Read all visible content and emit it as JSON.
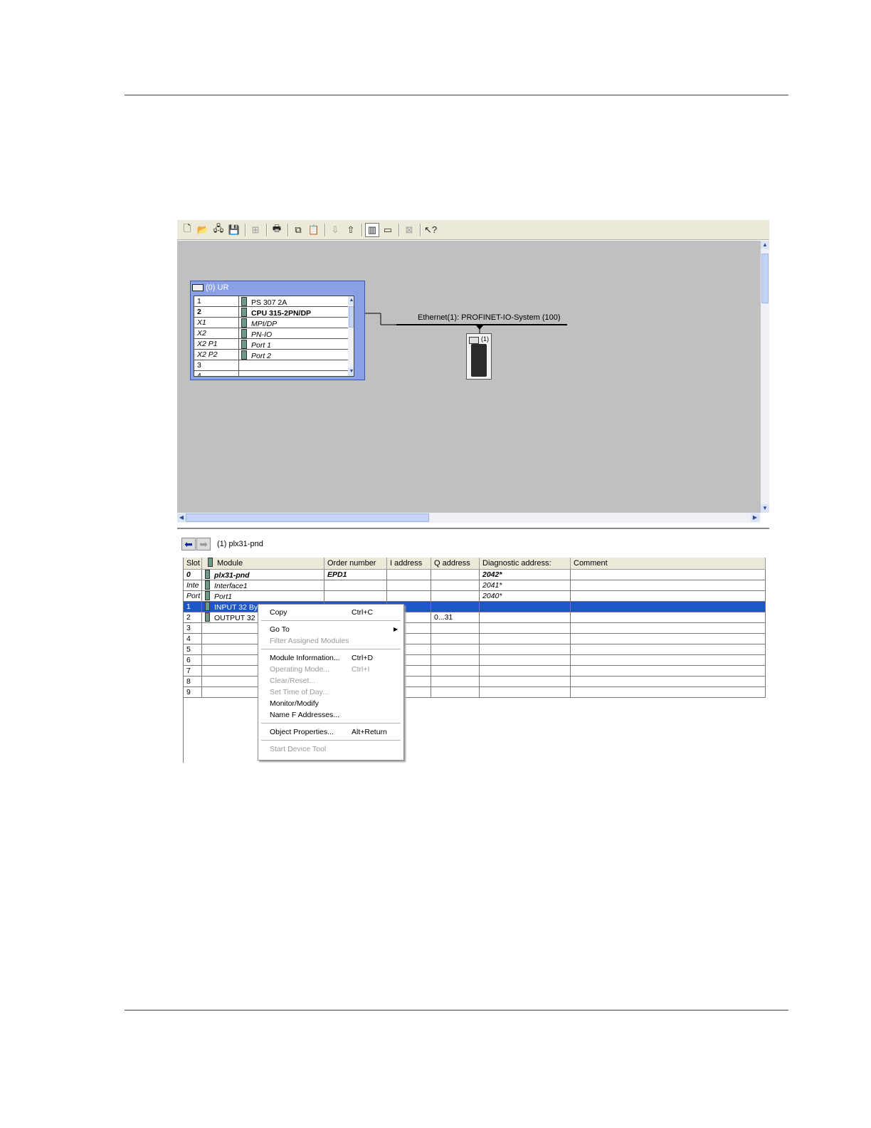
{
  "toolbar": {
    "icons": [
      {
        "name": "new-icon",
        "glyph": "🗋",
        "disabled": false
      },
      {
        "name": "open-icon",
        "glyph": "📂",
        "disabled": false
      },
      {
        "name": "accessible-nodes-icon",
        "glyph": "🖧",
        "disabled": false
      },
      {
        "name": "save-icon",
        "glyph": "💾",
        "disabled": true
      },
      {
        "name": "save-compile-icon",
        "glyph": "⊞",
        "disabled": true
      },
      {
        "name": "print-icon",
        "glyph": "🖶",
        "disabled": false
      },
      {
        "name": "copy-icon",
        "glyph": "⧉",
        "disabled": false
      },
      {
        "name": "paste-icon",
        "glyph": "📋",
        "disabled": true
      },
      {
        "name": "download-icon",
        "glyph": "⇩",
        "disabled": true
      },
      {
        "name": "upload-icon",
        "glyph": "⇧",
        "disabled": false
      },
      {
        "name": "catalog-icon",
        "glyph": "▥",
        "disabled": false,
        "active": true
      },
      {
        "name": "window-icon",
        "glyph": "▭",
        "disabled": false
      },
      {
        "name": "network-icon",
        "glyph": "⊠",
        "disabled": true
      },
      {
        "name": "help-icon",
        "glyph": "↖?",
        "disabled": false
      }
    ]
  },
  "rack": {
    "title": "(0) UR",
    "rows": [
      {
        "slot": "1",
        "module": "PS 307 2A",
        "bold": false,
        "italic": false
      },
      {
        "slot": "2",
        "module": "CPU 315-2PN/DP",
        "bold": true,
        "italic": false
      },
      {
        "slot": "X1",
        "module": "MPI/DP",
        "bold": false,
        "italic": true
      },
      {
        "slot": "X2",
        "module": "PN-IO",
        "bold": false,
        "italic": true
      },
      {
        "slot": "X2 P1",
        "module": "Port 1",
        "bold": false,
        "italic": true
      },
      {
        "slot": "X2 P2",
        "module": "Port 2",
        "bold": false,
        "italic": true
      },
      {
        "slot": "3",
        "module": "",
        "bold": false,
        "italic": false
      },
      {
        "slot": "4",
        "module": "",
        "bold": false,
        "italic": false
      }
    ]
  },
  "network": {
    "label": "Ethernet(1): PROFINET-IO-System (100)",
    "device_label": "(1)"
  },
  "detail": {
    "title": "(1)   plx31-pnd",
    "columns": [
      "Slot",
      "Module",
      "Order number",
      "I address",
      "Q address",
      "Diagnostic address:",
      "Comment"
    ],
    "rows": [
      {
        "slot": "0",
        "module": "plx31-pnd",
        "order": "EPD1",
        "iaddr": "",
        "qaddr": "",
        "diag": "2042*",
        "comment": "",
        "style": "bolditalic"
      },
      {
        "slot": "Inte",
        "module": "Interface1",
        "order": "",
        "iaddr": "",
        "qaddr": "",
        "diag": "2041*",
        "comment": "",
        "style": "italic"
      },
      {
        "slot": "Port",
        "module": "Port1",
        "order": "",
        "iaddr": "",
        "qaddr": "",
        "diag": "2040*",
        "comment": "",
        "style": "italic"
      },
      {
        "slot": "1",
        "module": "INPUT 32 By",
        "order": "",
        "iaddr": "",
        "qaddr": "",
        "diag": "",
        "comment": "",
        "style": "selected"
      },
      {
        "slot": "2",
        "module": "OUTPUT 32",
        "order": "",
        "iaddr": "",
        "qaddr": "0...31",
        "diag": "",
        "comment": "",
        "style": "normal"
      },
      {
        "slot": "3",
        "module": "",
        "order": "",
        "iaddr": "",
        "qaddr": "",
        "diag": "",
        "comment": "",
        "style": "normal"
      },
      {
        "slot": "4",
        "module": "",
        "order": "",
        "iaddr": "",
        "qaddr": "",
        "diag": "",
        "comment": "",
        "style": "normal"
      },
      {
        "slot": "5",
        "module": "",
        "order": "",
        "iaddr": "",
        "qaddr": "",
        "diag": "",
        "comment": "",
        "style": "normal"
      },
      {
        "slot": "6",
        "module": "",
        "order": "",
        "iaddr": "",
        "qaddr": "",
        "diag": "",
        "comment": "",
        "style": "normal"
      },
      {
        "slot": "7",
        "module": "",
        "order": "",
        "iaddr": "",
        "qaddr": "",
        "diag": "",
        "comment": "",
        "style": "normal"
      },
      {
        "slot": "8",
        "module": "",
        "order": "",
        "iaddr": "",
        "qaddr": "",
        "diag": "",
        "comment": "",
        "style": "normal"
      },
      {
        "slot": "9",
        "module": "",
        "order": "",
        "iaddr": "",
        "qaddr": "",
        "diag": "",
        "comment": "",
        "style": "normal"
      }
    ]
  },
  "context_menu": {
    "items": [
      {
        "label": "Copy",
        "shortcut": "Ctrl+C",
        "disabled": false
      },
      {
        "sep": true
      },
      {
        "label": "Go To",
        "shortcut": "",
        "disabled": false,
        "submenu": true
      },
      {
        "label": "Filter Assigned Modules",
        "shortcut": "",
        "disabled": true
      },
      {
        "sep": true
      },
      {
        "label": "Module Information...",
        "shortcut": "Ctrl+D",
        "disabled": false
      },
      {
        "label": "Operating Mode...",
        "shortcut": "Ctrl+I",
        "disabled": true
      },
      {
        "label": "Clear/Reset...",
        "shortcut": "",
        "disabled": true
      },
      {
        "label": "Set Time of Day...",
        "shortcut": "",
        "disabled": true
      },
      {
        "label": "Monitor/Modify",
        "shortcut": "",
        "disabled": false
      },
      {
        "label": "Name F Addresses...",
        "shortcut": "",
        "disabled": false
      },
      {
        "sep": true
      },
      {
        "label": "Object Properties...",
        "shortcut": "Alt+Return",
        "disabled": false
      },
      {
        "sep": true
      },
      {
        "label": "Start Device Tool",
        "shortcut": "",
        "disabled": true
      }
    ]
  },
  "colors": {
    "canvas": "#c0c0c0",
    "selection": "#1c56c8",
    "rack_frame": "#8aa0e6"
  }
}
